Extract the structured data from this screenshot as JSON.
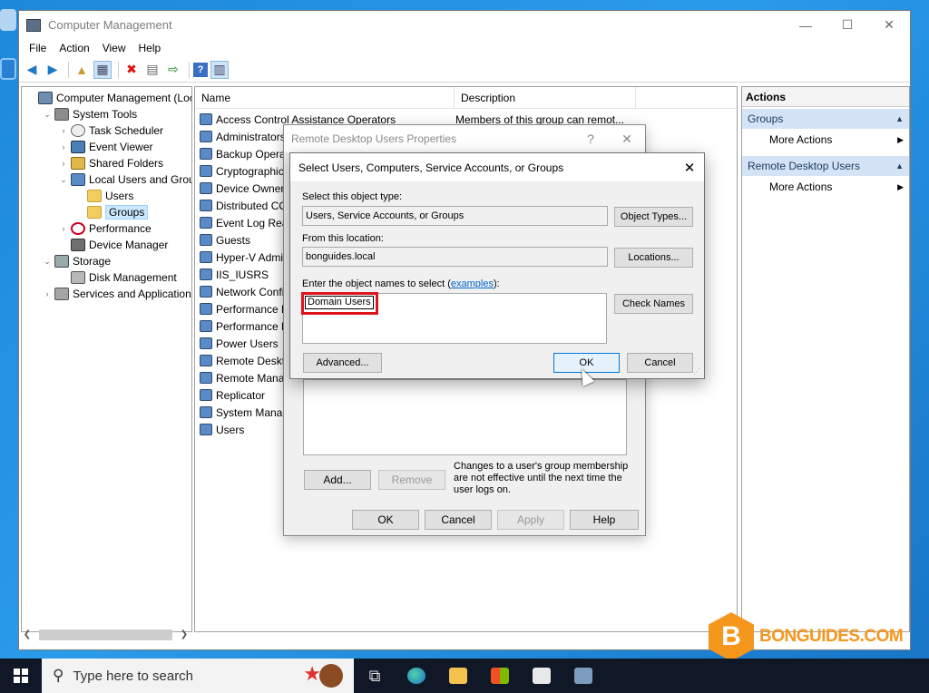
{
  "window": {
    "title": "Computer Management",
    "controls": {
      "minimize": "—",
      "maximize": "☐",
      "close": "✕"
    }
  },
  "menu": [
    "File",
    "Action",
    "View",
    "Help"
  ],
  "tree": [
    {
      "label": "Computer Management (Local",
      "level": 0,
      "exp": "",
      "icon": "comp"
    },
    {
      "label": "System Tools",
      "level": 1,
      "exp": "⌄",
      "icon": "tool"
    },
    {
      "label": "Task Scheduler",
      "level": 2,
      "exp": "›",
      "icon": "clock"
    },
    {
      "label": "Event Viewer",
      "level": 2,
      "exp": "›",
      "icon": "viewer"
    },
    {
      "label": "Shared Folders",
      "level": 2,
      "exp": "›",
      "icon": "share"
    },
    {
      "label": "Local Users and Groups",
      "level": 2,
      "exp": "⌄",
      "icon": "users"
    },
    {
      "label": "Users",
      "level": 3,
      "exp": "",
      "icon": "folder"
    },
    {
      "label": "Groups",
      "level": 3,
      "exp": "",
      "icon": "folder",
      "selected": true
    },
    {
      "label": "Performance",
      "level": 2,
      "exp": "›",
      "icon": "perf"
    },
    {
      "label": "Device Manager",
      "level": 2,
      "exp": "",
      "icon": "dev"
    },
    {
      "label": "Storage",
      "level": 1,
      "exp": "⌄",
      "icon": "store"
    },
    {
      "label": "Disk Management",
      "level": 2,
      "exp": "",
      "icon": "disk"
    },
    {
      "label": "Services and Applications",
      "level": 1,
      "exp": "›",
      "icon": "svc"
    }
  ],
  "list": {
    "columns": [
      "Name",
      "Description"
    ],
    "rows": [
      {
        "name": "Access Control Assistance Operators",
        "desc": "Members of this group can remot..."
      },
      {
        "name": "Administrators",
        "desc": ""
      },
      {
        "name": "Backup Operat",
        "desc": ""
      },
      {
        "name": "Cryptographic",
        "desc": ""
      },
      {
        "name": "Device Owners",
        "desc": ""
      },
      {
        "name": "Distributed CO",
        "desc": ""
      },
      {
        "name": "Event Log Rea",
        "desc": ""
      },
      {
        "name": "Guests",
        "desc": ""
      },
      {
        "name": "Hyper-V Admi",
        "desc": ""
      },
      {
        "name": "IIS_IUSRS",
        "desc": ""
      },
      {
        "name": "Network Confi",
        "desc": ""
      },
      {
        "name": "Performance L",
        "desc": ""
      },
      {
        "name": "Performance M",
        "desc": ""
      },
      {
        "name": "Power Users",
        "desc": ""
      },
      {
        "name": "Remote Deskto",
        "desc": ""
      },
      {
        "name": "Remote Manag",
        "desc": ""
      },
      {
        "name": "Replicator",
        "desc": ""
      },
      {
        "name": "System Manag",
        "desc": ""
      },
      {
        "name": "Users",
        "desc": ""
      }
    ]
  },
  "actions": {
    "header": "Actions",
    "sections": [
      {
        "title": "Groups",
        "item": "More Actions"
      },
      {
        "title": "Remote Desktop Users",
        "item": "More Actions"
      }
    ]
  },
  "props_dialog": {
    "title": "Remote Desktop Users Properties",
    "help": "?",
    "close": "✕",
    "add": "Add...",
    "remove": "Remove",
    "note": "Changes to a user's group membership are not effective until the next time the user logs on.",
    "ok": "OK",
    "cancel": "Cancel",
    "apply": "Apply",
    "help_btn": "Help"
  },
  "select_dialog": {
    "title": "Select Users, Computers, Service Accounts, or Groups",
    "close": "✕",
    "object_type_label": "Select this object type:",
    "object_type_value": "Users, Service Accounts, or Groups",
    "object_types_btn": "Object Types...",
    "location_label": "From this location:",
    "location_value": "bonguides.local",
    "locations_btn": "Locations...",
    "names_label_pre": "Enter the object names to select (",
    "names_label_link": "examples",
    "names_label_post": "):",
    "names_value": "Domain Users",
    "check_names_btn": "Check Names",
    "advanced_btn": "Advanced...",
    "ok": "OK",
    "cancel": "Cancel"
  },
  "watermark": {
    "letter": "B",
    "text": "BONGUIDES.COM"
  },
  "taskbar": {
    "search_placeholder": "Type here to search"
  },
  "colors": {
    "highlight": "#e0141e",
    "accent": "#0078d7",
    "taskbar": "#101827"
  }
}
